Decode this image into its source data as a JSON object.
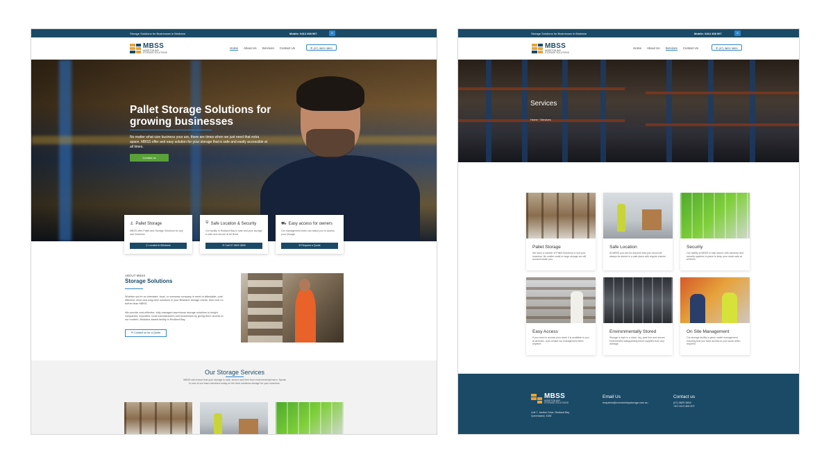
{
  "left_page": {
    "topbar": {
      "tagline": "Storage Solutions for Businesses in Brisbane",
      "mobile": "Mobile: 0413 408 907",
      "search_icon": "search-icon"
    },
    "logo": {
      "name": "MBSS",
      "sub1": "MORETON BAY",
      "sub2": "STORAGE SOLUTIONS"
    },
    "nav": {
      "links": [
        "Home",
        "About Us",
        "Services",
        "Contact Us"
      ],
      "active": "Home",
      "phone": "(07) 3829 3809"
    },
    "hero": {
      "title": "Pallet Storage Solutions for growing businesses",
      "subtitle": "No matter what size business your are, there are times when we just need that extra space. MBSS offer and easy solution for your storage that is safe and easily accessible at all times.",
      "button": "Contact us"
    },
    "features": [
      {
        "title": "Pallet Storage",
        "icon": "pallet-icon",
        "text": "MBSS offer Pallet and Storage Solutions for any size business",
        "button": "Located in Brisbane"
      },
      {
        "title": "Safe Location & Security",
        "icon": "shield-icon",
        "text": "Our facility in Redland Bay is safe and your storage is safe and secure at all times",
        "button": "Call 07 3829 3809"
      },
      {
        "title": "Easy access for owners",
        "icon": "truck-icon",
        "text": "Our management team can assist you to access your storage",
        "button": "Request a Quote"
      }
    ],
    "about": {
      "small": "ABOUT MBSS",
      "big": "Storage Solutions",
      "p1": "Whether you're an interstate, local, or overseas company in need of affordable, cost-effective, short and long-term solutions in your Brisbane storage needs, then look no further than MBSS.",
      "p2": "We provide cost-effective, fully-managed warehouse storage solutions to freight companies, importers, local manufacturers and businesses by giving them access to our modern, Brisbane-based facility in Redland Bay.",
      "button": "Contact us for a Quote"
    },
    "services": {
      "title": "Our Storage Services",
      "text": "MBSS will ensure that your storage is safe, secure and free from environmental harm. Speak to one of our team members today on the best solutions storage for your business."
    }
  },
  "right_page": {
    "topbar": {
      "tagline": "Storage Solutions for Businesses in Brisbane",
      "mobile": "Mobile: 0413 408 907",
      "search_icon": "search-icon"
    },
    "logo": {
      "name": "MBSS",
      "sub1": "MORETON BAY",
      "sub2": "STORAGE SOLUTIONS"
    },
    "nav": {
      "links": [
        "Home",
        "About Us",
        "Services",
        "Contact Us"
      ],
      "active": "Services",
      "phone": "(07) 3829 3809"
    },
    "hero": {
      "title": "Services",
      "crumb_home": "Home",
      "crumb_sep": "›",
      "crumb_current": "Services"
    },
    "cards": [
      {
        "title": "Pallet Storage",
        "text": "We have a number of Pallet Solutions to suit your business. No matter small or large storage we will accommodate you."
      },
      {
        "title": "Safe Location",
        "text": "At MBSS you can be assured that your stock will always be stored in a safe place with regular checks."
      },
      {
        "title": "Security",
        "text": "Our facility at MBSS is fully secure with cameras and security systems in place to keep your stock safe at all times."
      },
      {
        "title": "Easy Access",
        "text": "If you need to access your stock it is available to you at all times. Just contact our management team anytime."
      },
      {
        "title": "Environmentally Stored",
        "text": "Storage is kept in a clean, dry, pest free and secure environment safeguarding future supplies from any damage."
      },
      {
        "title": "On Site Management",
        "text": "Our storage facility is given onsite management ensuring that you have access to your stock when required."
      }
    ],
    "footer": {
      "address": "Unit 7, Jardine Drive, Redland Bay Queensland, 4165",
      "email_heading": "Email Us",
      "email": "enquiries@moretonbaystorage.com.au",
      "contact_heading": "Contact us",
      "phone1": "(07) 3829 3809",
      "phone2": "+61 0413 408 907"
    }
  },
  "colors": {
    "navy": "#1b4a66",
    "accent_blue": "#2f86c9",
    "green": "#5aa13a",
    "orange": "#e7a33b"
  }
}
